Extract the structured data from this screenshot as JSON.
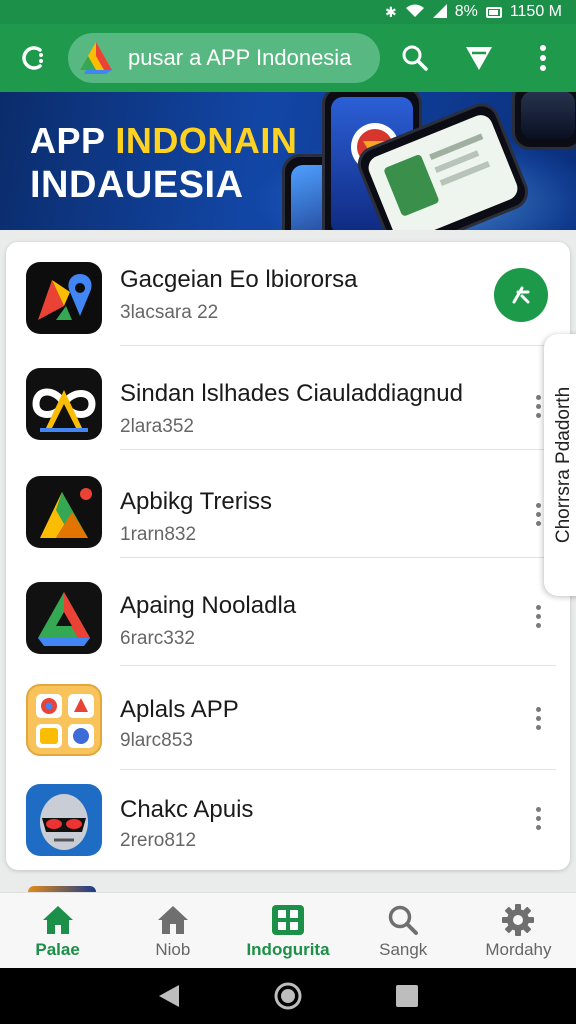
{
  "status_bar": {
    "battery": "8%",
    "time": "1150 M"
  },
  "app_bar": {
    "search_text": "pusar a APP Indonesia"
  },
  "banner": {
    "title_part1": "APP ",
    "title_highlight": "INDONAIN",
    "title_line2": "INDAUESIA"
  },
  "apps": [
    {
      "title": "Gacgeian Eo lbiororsa",
      "subtitle": "3lacsara 22",
      "icon": "maps-pin-icon"
    },
    {
      "title": "Sindan lslhades Ciauladdiagnud",
      "subtitle": "2lara352",
      "icon": "infinity-logo-icon"
    },
    {
      "title": "Apbikg Treriss",
      "subtitle": "1rarn832",
      "icon": "drive-triangle-icon"
    },
    {
      "title": "Apaing Nooladla",
      "subtitle": "6rarc332",
      "icon": "drive-logo-icon"
    },
    {
      "title": "Aplals APP",
      "subtitle": "9larc853",
      "icon": "app-folder-icon"
    },
    {
      "title": "Chakc Apuis",
      "subtitle": "2rero812",
      "icon": "robot-mask-icon"
    }
  ],
  "side_tab": {
    "label": "Chorrsra Pdadorth"
  },
  "bottom_nav": [
    {
      "label": "Palae",
      "icon": "home-icon",
      "active": true
    },
    {
      "label": "Niob",
      "icon": "home-outline-icon",
      "active": false
    },
    {
      "label": "Indogurita",
      "icon": "grid-icon",
      "active": true
    },
    {
      "label": "Sangk",
      "icon": "search-icon",
      "active": false
    },
    {
      "label": "Mordahy",
      "icon": "gear-icon",
      "active": false
    }
  ],
  "colors": {
    "primary": "#1f9a4d",
    "status_bar": "#1c8f48",
    "accent_text": "#ffd21f"
  }
}
